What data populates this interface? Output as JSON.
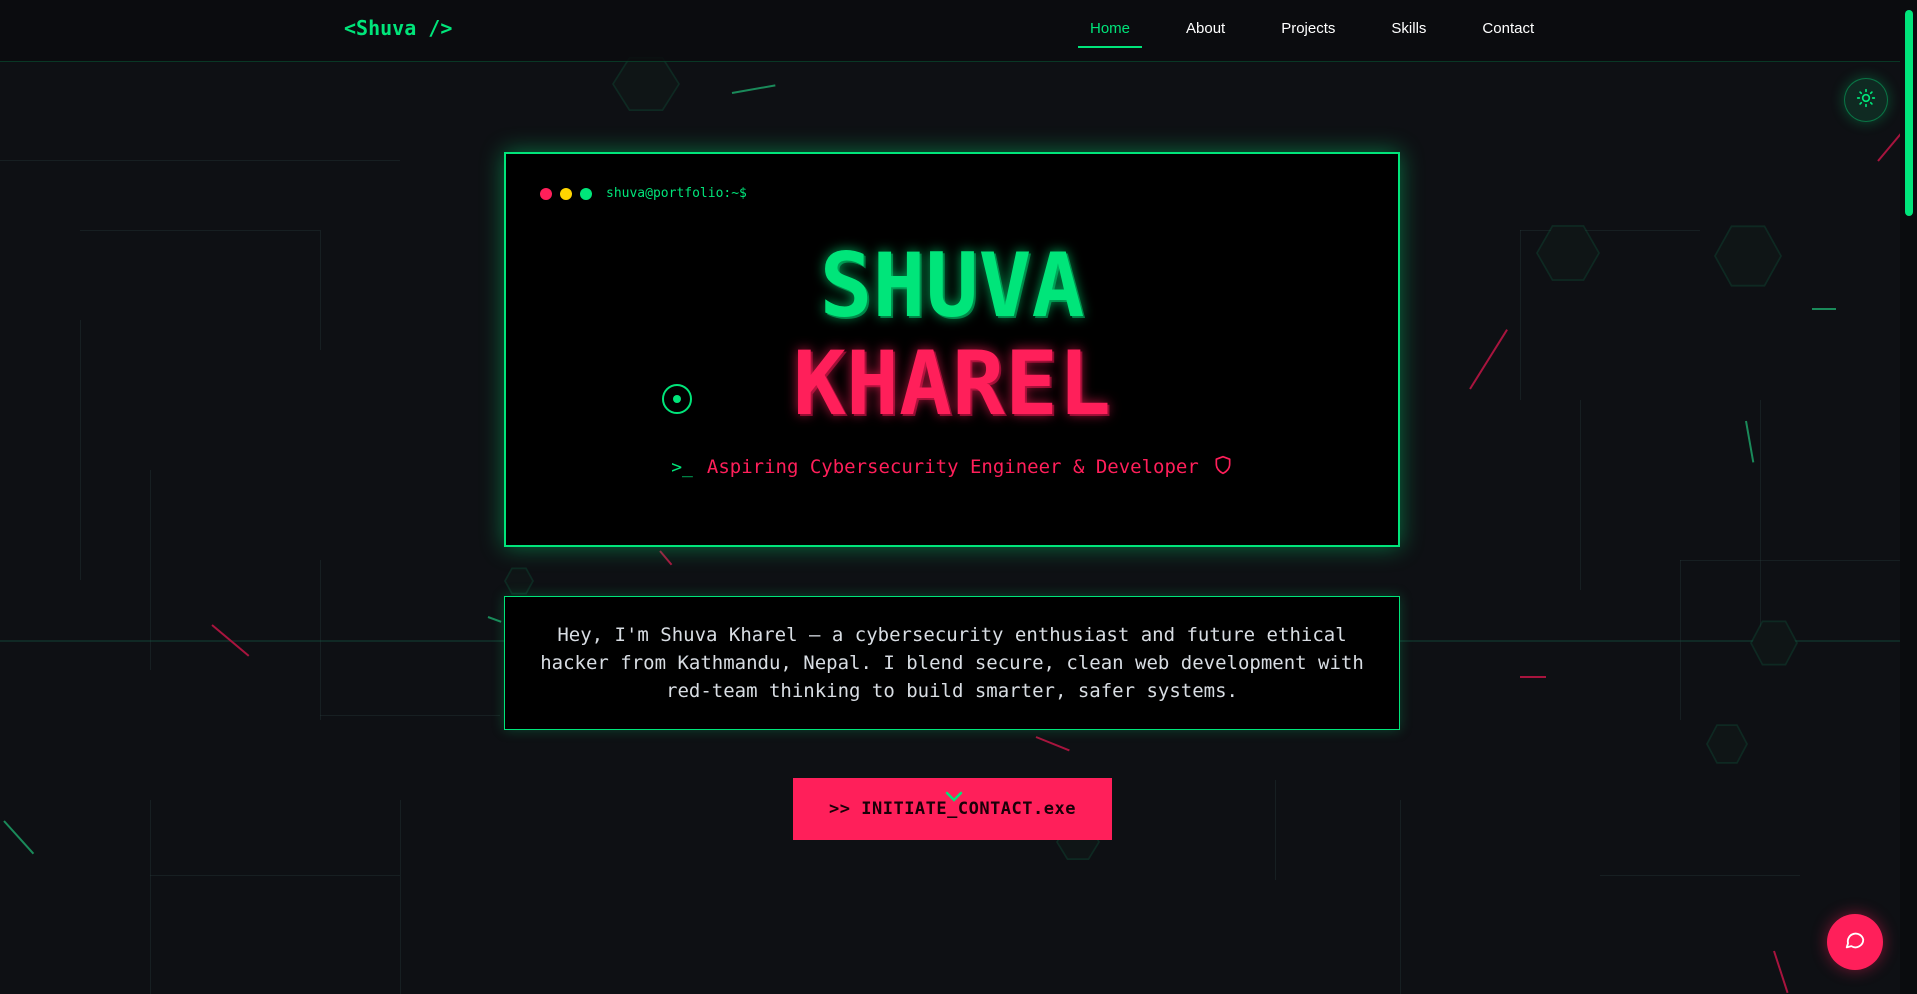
{
  "nav": {
    "logo": "<Shuva />",
    "links": [
      "Home",
      "About",
      "Projects",
      "Skills",
      "Contact"
    ],
    "active": "Home"
  },
  "terminal": {
    "prompt": "shuva@portfolio:~$",
    "first_name": "SHUVA",
    "last_name": "KHAREL",
    "tagline_prefix": ">_",
    "tagline": "Aspiring Cybersecurity Engineer & Developer"
  },
  "bio": {
    "text": "Hey, I'm Shuva Kharel — a cybersecurity enthusiast and future ethical hacker from Kathmandu, Nepal. I blend secure, clean web development with red-team thinking to build smarter, safer systems."
  },
  "cta": {
    "label": ">> INITIATE_CONTACT.exe"
  },
  "icons": {
    "theme_toggle": "sun-icon",
    "tagline_badge": "shield-icon",
    "chat": "chat-bubble-icon",
    "scroll_hint": "chevron-down-icon"
  },
  "colors": {
    "accent": "#00e57a",
    "secondary": "#ff1f5a",
    "background": "#0e1014",
    "card": "#000000"
  }
}
